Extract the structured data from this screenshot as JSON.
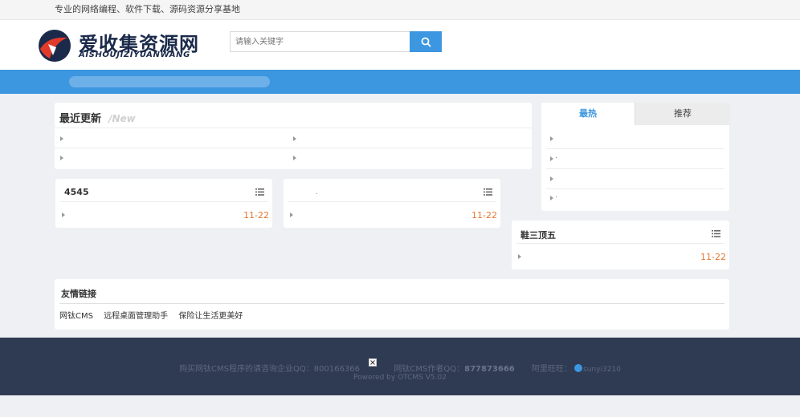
{
  "topbar": {
    "slogan": "专业的网络编程、软件下载、源码资源分享基地"
  },
  "logo": {
    "cn_name": "爱收集资源网",
    "en_name": "AISHOUJIZIYUANWANG"
  },
  "search": {
    "placeholder": "请输入关键字",
    "icon": "search-icon"
  },
  "latest": {
    "title": "最近更新",
    "subtitle": "/New"
  },
  "hot_tabs": {
    "tabs": [
      "最热",
      "推荐"
    ],
    "active": "最热",
    "items": [
      "",
      ".",
      "",
      "."
    ]
  },
  "box_4545": {
    "title": "4545",
    "row_date": "11-22"
  },
  "box_unnamed": {
    "title": "",
    "row_text": ".",
    "row_date": "11-22"
  },
  "box_tingsan": {
    "title": "鞋三顶五",
    "row_date": "11-22"
  },
  "friend_links": {
    "title": "友情链接",
    "links": [
      "网钛CMS",
      "远程桌面管理助手",
      "保险让生活更美好"
    ]
  },
  "footer": {
    "buy_text": "购买网钛CMS程序的请咨询企业QQ：800166366",
    "author_label": "网钛CMS作者QQ：",
    "author_qq": "877873666",
    "wangwang_label": "阿里旺旺：",
    "wangwang_id": "sunyi3210",
    "powered": "Powered by OTCMS V5.02"
  },
  "colors": {
    "accent": "#3d96e0",
    "date": "#e6762c",
    "footer_bg": "#2f3b52"
  }
}
